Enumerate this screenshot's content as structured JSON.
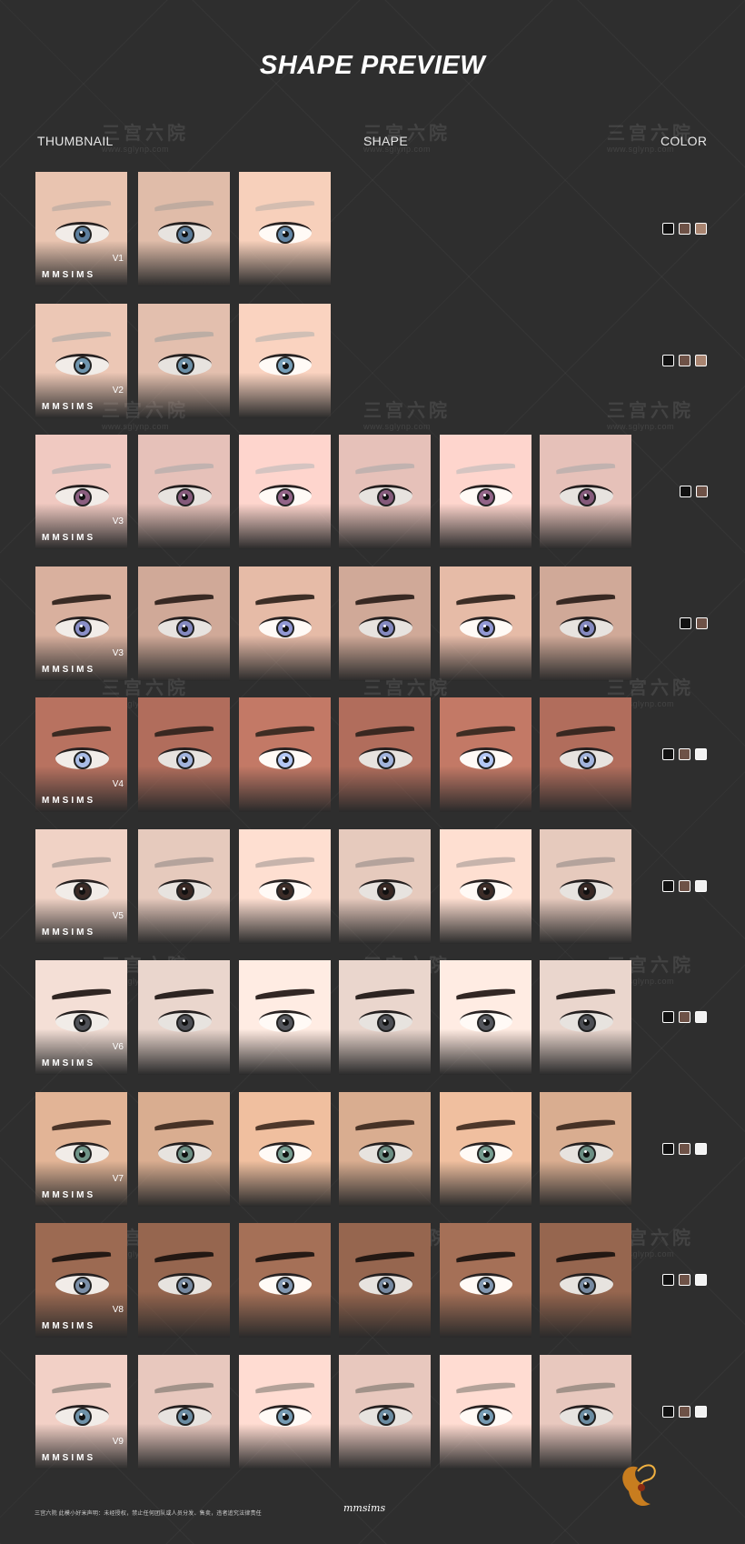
{
  "title": "SHAPE PREVIEW",
  "headers": {
    "thumbnail": "THUMBNAIL",
    "shape": "SHAPE",
    "color": "COLOR"
  },
  "brand": "MMSIMS",
  "signature": "mmsims",
  "footnote": "三宫六院 此模小好米声明：未经授权，禁止任何团队或人员分发、售卖，违者追究法律责任",
  "watermark": {
    "text": "三宫六院",
    "url": "www.sglynp.com"
  },
  "rows": [
    {
      "label": "V1",
      "shapes": 2,
      "skin": "#e9c4b0",
      "brow": "#c8b2a6",
      "iris": "#5d7f9e",
      "swatches": [
        "#111111",
        "#6e5247",
        "#a88470"
      ]
    },
    {
      "label": "V2",
      "shapes": 2,
      "skin": "#ecc7b5",
      "brow": "#c4b4ab",
      "iris": "#6f95ae",
      "swatches": [
        "#111111",
        "#6e5247",
        "#a88470"
      ]
    },
    {
      "label": "V3",
      "shapes": 5,
      "skin": "#f0c9c1",
      "brow": "#c9b9b6",
      "iris": "#8b5e80",
      "swatches": [
        "#111111",
        "#6e5247"
      ]
    },
    {
      "label": "V3",
      "shapes": 5,
      "skin": "#d9b09e",
      "brow": "#3a2b24",
      "iris": "#8a8fc8",
      "swatches": [
        "#111111",
        "#6e5247"
      ]
    },
    {
      "label": "V4",
      "shapes": 5,
      "skin": "#b87260",
      "brow": "#3b2a22",
      "iris": "#a9bce6",
      "swatches": [
        "#111111",
        "#6e5247",
        "#f2f2f2"
      ]
    },
    {
      "label": "V5",
      "shapes": 5,
      "skin": "#f0d2c5",
      "brow": "#bcaaa2",
      "iris": "#3a2a26",
      "swatches": [
        "#111111",
        "#6e5247",
        "#f2f2f2"
      ]
    },
    {
      "label": "V6",
      "shapes": 5,
      "skin": "#f4dfd6",
      "brow": "#2f2522",
      "iris": "#4f5157",
      "swatches": [
        "#111111",
        "#6e5247",
        "#f2f2f2"
      ]
    },
    {
      "label": "V7",
      "shapes": 5,
      "skin": "#e2b496",
      "brow": "#4a3428",
      "iris": "#6f9488",
      "swatches": [
        "#111111",
        "#6e5247",
        "#f2f2f2"
      ]
    },
    {
      "label": "V8",
      "shapes": 5,
      "skin": "#9c6a52",
      "brow": "#241914",
      "iris": "#7b8fa8",
      "swatches": [
        "#111111",
        "#6e5247",
        "#f2f2f2"
      ]
    },
    {
      "label": "V9",
      "shapes": 5,
      "skin": "#f2d0c6",
      "brow": "#a8988f",
      "iris": "#6f92a9",
      "swatches": [
        "#111111",
        "#6e5247",
        "#f2f2f2"
      ]
    }
  ]
}
